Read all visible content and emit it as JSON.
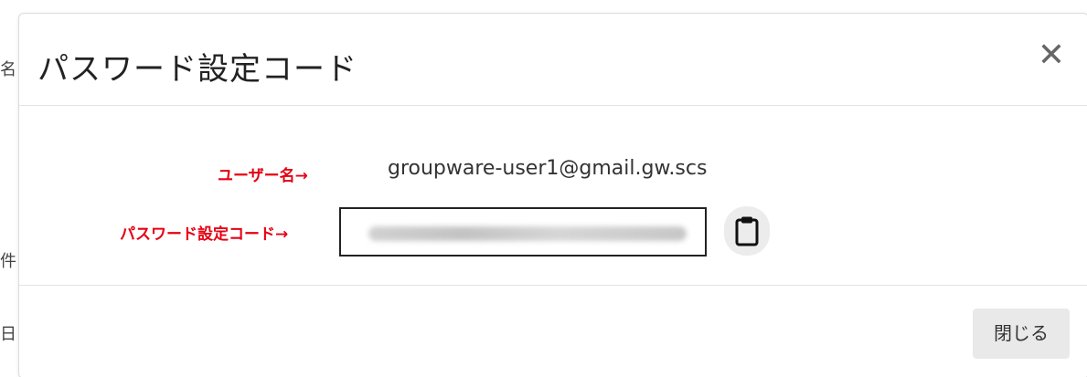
{
  "dialog": {
    "title": "パスワード設定コード",
    "close_glyph": "✕",
    "close_label": "閉じる"
  },
  "fields": {
    "username_value": "groupware-user1@gmail.gw.scs",
    "code_value_blurred": true
  },
  "annotations": {
    "username": "ユーザー名→",
    "code": "パスワード設定コード→",
    "color": "#e60012"
  },
  "icons": {
    "copy": "clipboard-icon",
    "close": "close-icon"
  }
}
